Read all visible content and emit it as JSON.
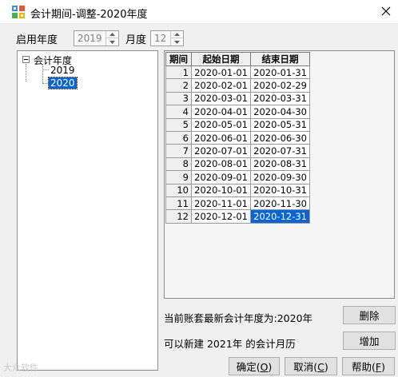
{
  "window": {
    "title": "会计期间-调整-2020年度"
  },
  "header": {
    "start_year_label": "启用年度",
    "start_year_value": "2019",
    "month_label": "月度",
    "month_value": "12"
  },
  "tree": {
    "root_label": "会计年度",
    "children": [
      "2019",
      "2020"
    ],
    "selected": "2020"
  },
  "grid": {
    "columns": [
      "期间",
      "起始日期",
      "结束日期"
    ],
    "rows": [
      [
        "1",
        "2020-01-01",
        "2020-01-31"
      ],
      [
        "2",
        "2020-02-01",
        "2020-02-29"
      ],
      [
        "3",
        "2020-03-01",
        "2020-03-31"
      ],
      [
        "4",
        "2020-04-01",
        "2020-04-30"
      ],
      [
        "5",
        "2020-05-01",
        "2020-05-31"
      ],
      [
        "6",
        "2020-06-01",
        "2020-06-30"
      ],
      [
        "7",
        "2020-07-01",
        "2020-07-31"
      ],
      [
        "8",
        "2020-08-01",
        "2020-08-31"
      ],
      [
        "9",
        "2020-09-01",
        "2020-09-30"
      ],
      [
        "10",
        "2020-10-01",
        "2020-10-31"
      ],
      [
        "11",
        "2020-11-01",
        "2020-11-30"
      ],
      [
        "12",
        "2020-12-01",
        "2020-12-31"
      ]
    ],
    "selected_cell": "2020-12-31"
  },
  "status": {
    "latest_year_text": "当前账套最新会计年度为:2020年",
    "new_calendar_text": "可以新建 2021年 的会计月历"
  },
  "buttons": {
    "delete": "删除",
    "add": "增加",
    "ok": "确定(O)",
    "cancel": "取消(C)",
    "help": "帮助(F)"
  },
  "watermark": "大众软件"
}
